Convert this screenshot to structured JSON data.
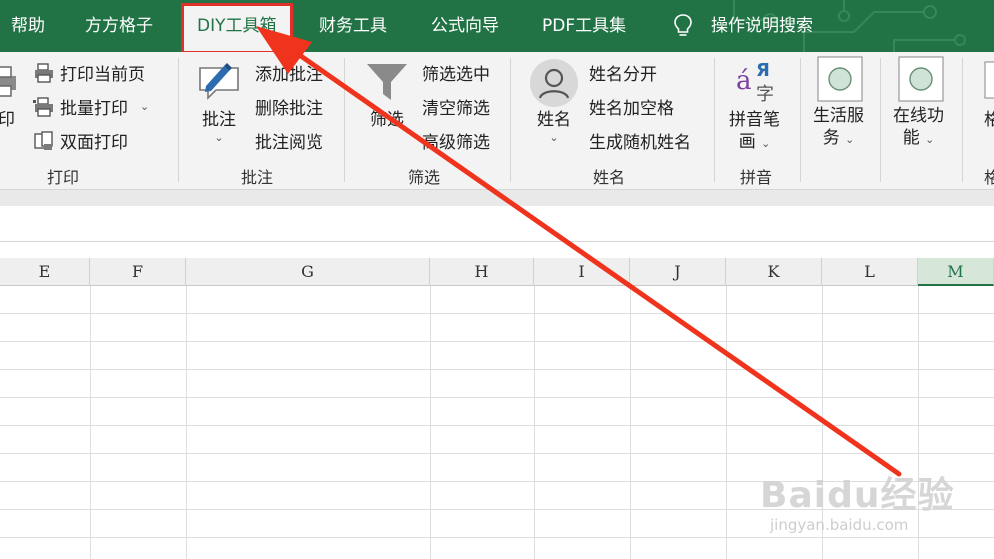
{
  "tabs": [
    {
      "label": "帮助"
    },
    {
      "label": "方方格子"
    },
    {
      "label": "DIY工具箱",
      "active": true
    },
    {
      "label": "财务工具"
    },
    {
      "label": "公式向导"
    },
    {
      "label": "PDF工具集"
    }
  ],
  "search": {
    "label": "操作说明搜索",
    "icon": "lightbulb-icon"
  },
  "groups": {
    "print": {
      "label": "打印",
      "big_label": "印",
      "items": [
        {
          "label": "打印当前页",
          "icon": "printer-icon"
        },
        {
          "label": "批量打印",
          "icon": "batch-printer-icon"
        },
        {
          "label": "双面打印",
          "icon": "duplex-print-icon"
        }
      ]
    },
    "comment": {
      "label": "批注",
      "big_label": "批注",
      "items": [
        {
          "label": "添加批注"
        },
        {
          "label": "删除批注"
        },
        {
          "label": "批注阅览"
        }
      ]
    },
    "filter": {
      "label": "筛选",
      "big_label": "筛选",
      "items": [
        {
          "label": "筛选选中"
        },
        {
          "label": "清空筛选"
        },
        {
          "label": "高级筛选"
        }
      ]
    },
    "name": {
      "label": "姓名",
      "big_label": "姓名",
      "items": [
        {
          "label": "姓名分开"
        },
        {
          "label": "姓名加空格"
        },
        {
          "label": "生成随机姓名"
        }
      ]
    },
    "pinyin": {
      "label": "拼音",
      "big_label_1": "拼音笔",
      "big_label_2": "画",
      "glyph_a": "á",
      "glyph_ya": "Я",
      "glyph_zi": "字"
    },
    "life": {
      "big_label_1": "生活服",
      "big_label_2": "务"
    },
    "online": {
      "big_label_1": "在线功",
      "big_label_2": "能"
    },
    "cut": {
      "big_label": "格",
      "label": "格"
    }
  },
  "columns": [
    "E",
    "F",
    "G",
    "H",
    "I",
    "J",
    "K",
    "L",
    "M"
  ],
  "selected_column": "M",
  "watermark": {
    "main": "Baidu经验",
    "sub": "jingyan.baidu.com"
  },
  "colors": {
    "tab_bg": "#217346",
    "highlight": "#e0302a",
    "arrow": "#f0331d"
  }
}
